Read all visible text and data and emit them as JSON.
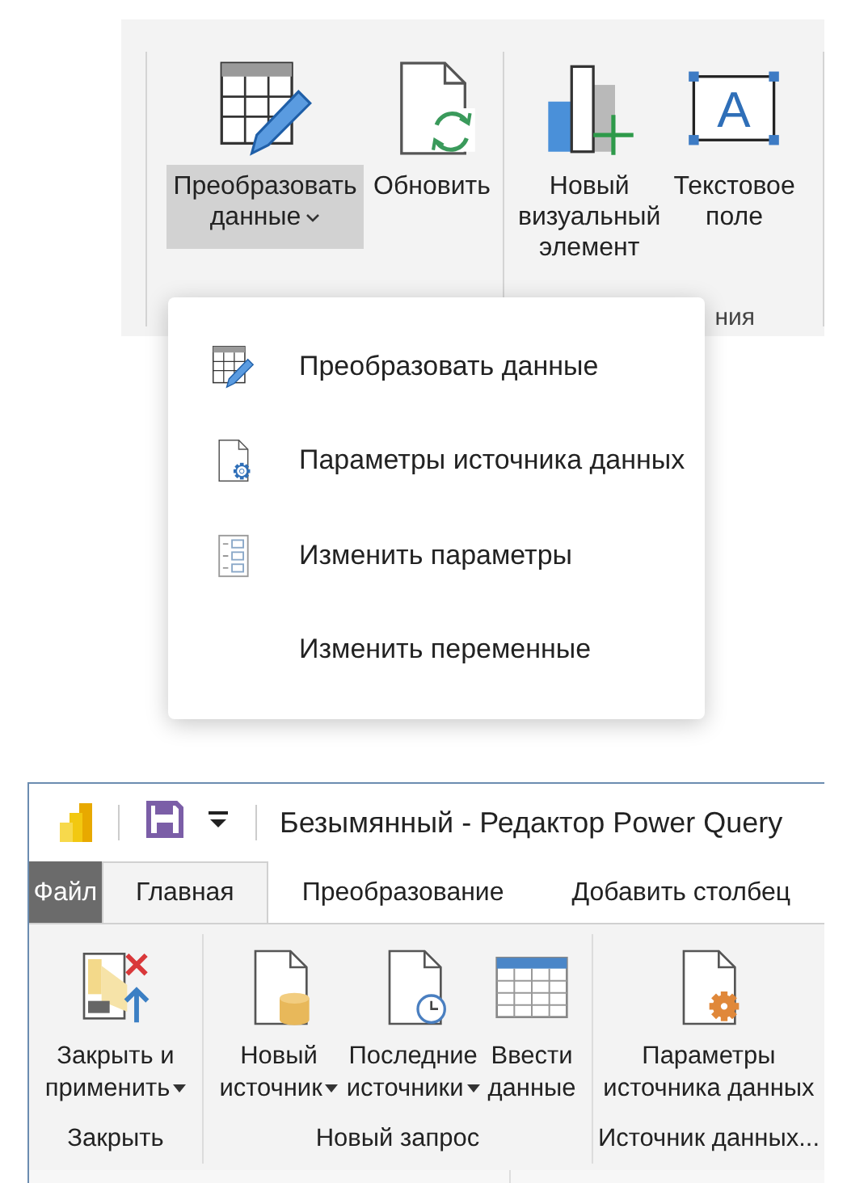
{
  "ribbon": {
    "groups": [
      {
        "buttons": [
          {
            "lines": [
              "Преобразовать",
              "данные"
            ],
            "kind": "split",
            "pressed": true
          },
          {
            "lines": [
              "Обновить"
            ],
            "kind": "large"
          }
        ]
      },
      {
        "buttons": [
          {
            "lines": [
              "Новый",
              "визуальный",
              "элемент"
            ],
            "kind": "large"
          },
          {
            "lines": [
              "Текстовое",
              "поле"
            ],
            "kind": "large",
            "glyph": "A"
          }
        ],
        "label": "ния"
      }
    ]
  },
  "menu": {
    "items": [
      {
        "label": "Преобразовать данные"
      },
      {
        "label": "Параметры источника данных"
      },
      {
        "label": "Изменить параметры"
      },
      {
        "label": "Изменить переменные"
      }
    ]
  },
  "editor": {
    "title": "Безымянный - Редактор Power Query",
    "tabs": [
      {
        "label": "Файл",
        "kind": "file",
        "selected": false
      },
      {
        "label": "Главная",
        "kind": "tab",
        "selected": true
      },
      {
        "label": "Преобразование",
        "kind": "tab",
        "selected": false
      },
      {
        "label": "Добавить столбец",
        "kind": "tab",
        "selected": false
      }
    ],
    "groups": [
      {
        "label": "Закрыть",
        "buttons": [
          {
            "lines": [
              "Закрыть и",
              "применить"
            ],
            "dropdown": true
          }
        ]
      },
      {
        "label": "Новый запрос",
        "buttons": [
          {
            "lines": [
              "Новый",
              "источник"
            ],
            "dropdown": true
          },
          {
            "lines": [
              "Последние",
              "источники"
            ],
            "dropdown": true
          },
          {
            "lines": [
              "Ввести",
              "данные"
            ],
            "dropdown": false
          }
        ]
      },
      {
        "label": "Источник данных...",
        "buttons": [
          {
            "lines": [
              "Параметры",
              "источника данных"
            ],
            "dropdown": false
          }
        ]
      }
    ]
  }
}
